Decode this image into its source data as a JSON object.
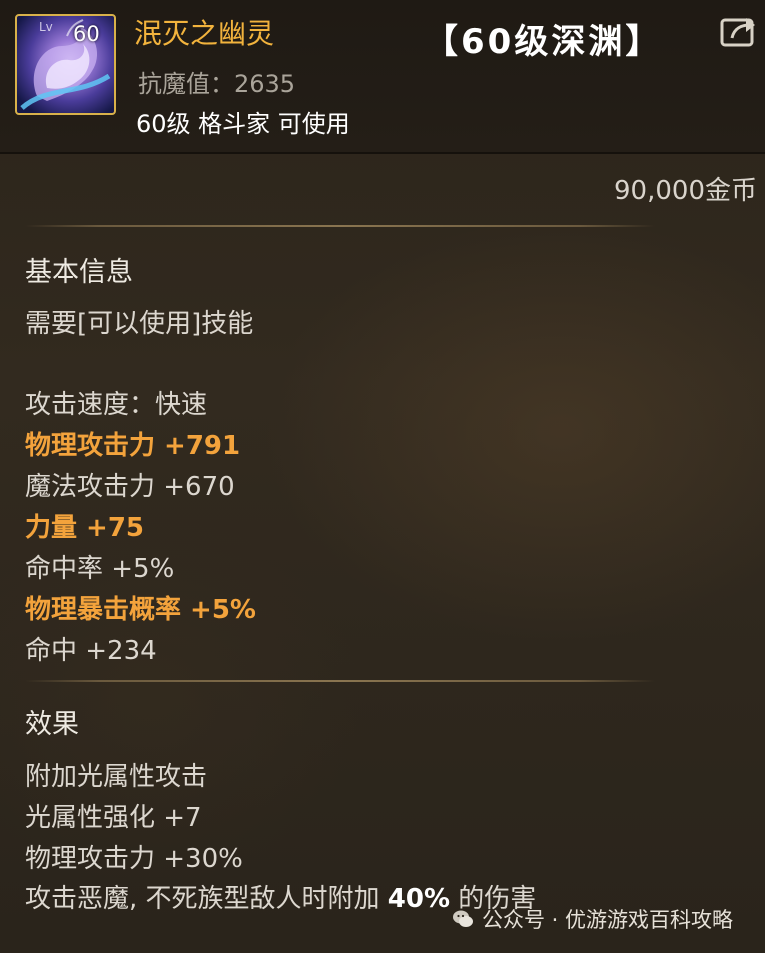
{
  "header": {
    "icon_level_prefix": "Lv",
    "icon_level": "60",
    "item_name": "泯灭之幽灵",
    "resist_label": "抗魔值：",
    "resist_value": "2635",
    "requirement": "60级 格斗家 可使用",
    "title_tag": "【60级深渊】"
  },
  "price": "90,000金币",
  "basic": {
    "title": "基本信息",
    "skill_req": "需要[可以使用]技能",
    "attack_speed_label": "攻击速度：",
    "attack_speed_value": "快速",
    "stats": [
      {
        "text": "物理攻击力 +791",
        "color": "#f3a33c"
      },
      {
        "text": "魔法攻击力 +670",
        "color": "#dcd7cf"
      },
      {
        "text": "力量 +75",
        "color": "#f3a33c"
      },
      {
        "text": "命中率 +5%",
        "color": "#dcd7cf"
      },
      {
        "text": "物理暴击概率 +5%",
        "color": "#f3a33c"
      },
      {
        "text": "命中 +234",
        "color": "#dcd7cf"
      }
    ]
  },
  "effects": {
    "title": "效果",
    "lines": [
      "附加光属性攻击",
      "光属性强化 +7",
      "物理攻击力 +30%"
    ],
    "last_line_prefix": "攻击恶魔, 不死族型敌人时附加 ",
    "last_line_value": "40%",
    "last_line_suffix": " 的伤害"
  },
  "watermark": {
    "text": "公众号 · 优游游戏百科攻略",
    "icon": "wechat-icon"
  },
  "colors": {
    "name_gold": "#f2b33d",
    "stat_orange": "#f3a33c",
    "background": "#2a241b"
  }
}
